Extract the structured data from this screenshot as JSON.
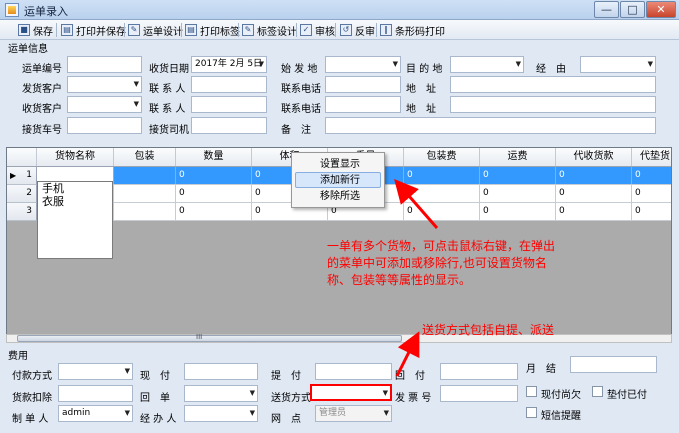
{
  "window": {
    "title": "运单录入",
    "minimize": "—",
    "maximize": "□",
    "close": "✕"
  },
  "toolbar": {
    "save": "保存",
    "print_save": "打印并保存",
    "waybill_design": "运单设计",
    "print_label": "打印标签",
    "label_design": "标签设计",
    "audit": "审核",
    "reverse_audit": "反审",
    "barcode_print": "条形码打印"
  },
  "waybill_info": {
    "section": "运单信息",
    "waybill_no_label": "运单编号",
    "receive_date_label": "收货日期",
    "receive_date_value": "2017年 2月 5日",
    "origin_label": "始 发 地",
    "destination_label": "目 的 地",
    "via_label": "经　由",
    "shipper_label": "发货客户",
    "contact1_label": "联 系 人",
    "phone1_label": "联系电话",
    "address1_label": "地　址",
    "consignee_label": "收货客户",
    "contact2_label": "联 系 人",
    "phone2_label": "联系电话",
    "address2_label": "地　址",
    "pickup_vehicle_label": "接货车号",
    "pickup_driver_label": "接货司机",
    "remark_label": "备　注"
  },
  "grid": {
    "columns": [
      "货物名称",
      "包装",
      "数量",
      "体积",
      "重量",
      "包装费",
      "运费",
      "代收货款",
      "代垫货"
    ],
    "rows": [
      {
        "num": "1",
        "cells": [
          "",
          "",
          "0",
          "0",
          "0",
          "0",
          "0",
          "0",
          "0"
        ]
      },
      {
        "num": "2",
        "cells": [
          "",
          "",
          "0",
          "0",
          "0",
          "0",
          "0",
          "0",
          "0"
        ]
      },
      {
        "num": "3",
        "cells": [
          "",
          "",
          "0",
          "0",
          "0",
          "0",
          "0",
          "0",
          "0"
        ]
      }
    ],
    "goods_dropdown": [
      "手机",
      "衣服"
    ],
    "scroll_grip": "III"
  },
  "context_menu": {
    "items": [
      "设置显示",
      "添加新行",
      "移除所选"
    ]
  },
  "fees": {
    "section": "费用",
    "payment_method_label": "付款方式",
    "cash_pay_label": "现　付",
    "pickup_pay_label": "提　付",
    "return_pay_label": "回　付",
    "monthly_label": "月　结",
    "payment_deduct_label": "货款扣除",
    "receipt_label": "回　单",
    "delivery_method_label": "送货方式",
    "invoice_no_label": "发 票 号",
    "cash_owed_label": "现付尚欠",
    "advance_paid_label": "垫付已付",
    "operator_label": "制 单 人",
    "operator_value": "admin",
    "handler_label": "经 办 人",
    "branch_label": "网　点",
    "branch_value": "管理员",
    "sms_label": "短信提醒"
  },
  "annotations": {
    "note1": "一单有多个货物，可点击鼠标右键，在弹出的菜单中可添加或移除行,也可设置货物名称、包装等等属性的显示。",
    "note2": "送货方式包括自提、派送"
  }
}
